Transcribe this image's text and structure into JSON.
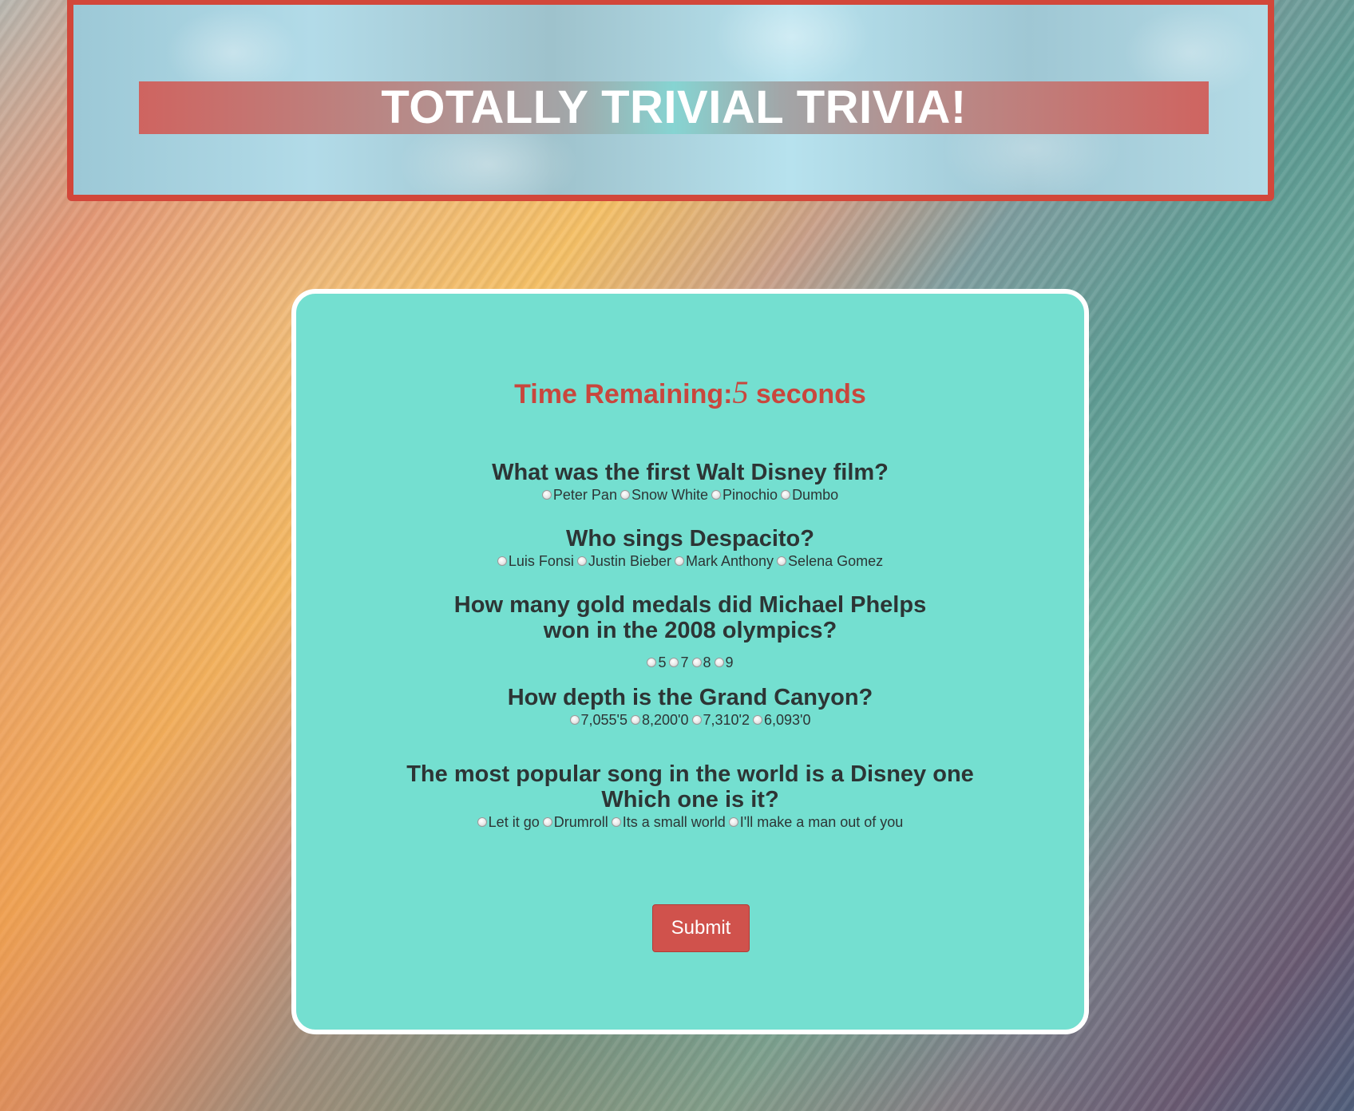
{
  "header": {
    "title": "TOTALLY TRIVIAL TRIVIA!"
  },
  "timer": {
    "label": "Time Remaining:",
    "value": "5",
    "unit": " seconds"
  },
  "questions": [
    {
      "text": "What was the first Walt Disney film?",
      "options": [
        "Peter Pan",
        "Snow White",
        "Pinochio",
        "Dumbo"
      ]
    },
    {
      "text": "Who sings Despacito?",
      "options": [
        "Luis Fonsi",
        "Justin Bieber",
        "Mark Anthony",
        "Selena Gomez"
      ]
    },
    {
      "text": "How many gold medals did Michael Phelps won in the 2008 olympics?",
      "options": [
        "5",
        "7",
        "8",
        "9"
      ]
    },
    {
      "text": "How depth is the Grand Canyon?",
      "options": [
        "7,055'5",
        "8,200'0",
        "7,310'2",
        "6,093'0"
      ]
    },
    {
      "text": "The most popular song in the world is a Disney one Which one is it?",
      "options": [
        "Let it go",
        "Drumroll",
        "Its a small world",
        "I'll make a man out of you"
      ]
    }
  ],
  "submit": {
    "label": "Submit"
  },
  "colors": {
    "card": "#74dfd0",
    "accent": "#d0524c",
    "timer": "#c9463d",
    "header_border": "#d2473a"
  }
}
